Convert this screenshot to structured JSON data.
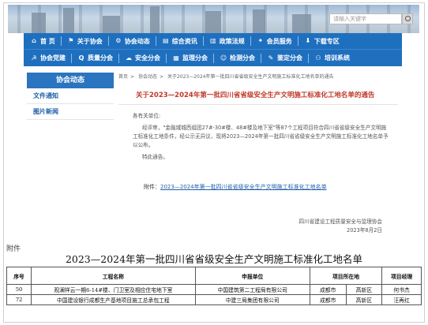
{
  "header": {
    "search_placeholder": "请输入关键字"
  },
  "nav": {
    "row1": [
      {
        "icon": "home-icon",
        "glyph": "⌂",
        "label": "首 页"
      },
      {
        "icon": "flag-icon",
        "glyph": "⚑",
        "label": "关于协会"
      },
      {
        "icon": "news-icon",
        "glyph": "⚙",
        "label": "协会动态"
      },
      {
        "icon": "doc-icon",
        "glyph": "▤",
        "label": "综合资讯"
      },
      {
        "icon": "book-icon",
        "glyph": "▥",
        "label": "政策法规"
      },
      {
        "icon": "star-icon",
        "glyph": "✦",
        "label": "会员服务"
      },
      {
        "icon": "download-icon",
        "glyph": "⬇",
        "label": "下载专区"
      }
    ],
    "row2": [
      {
        "icon": "party-icon",
        "glyph": "☭",
        "label": "协会党建"
      },
      {
        "icon": "quality-icon",
        "glyph": "Q",
        "label": "质量分会"
      },
      {
        "icon": "safety-icon",
        "glyph": "☁",
        "label": "安全分会"
      },
      {
        "icon": "supervise-icon",
        "glyph": "▦",
        "label": "监理分会"
      },
      {
        "icon": "test-icon",
        "glyph": "☺",
        "label": "检测分会"
      },
      {
        "icon": "eval-icon",
        "glyph": "✎",
        "label": "鉴定分会"
      },
      {
        "icon": "train-icon",
        "glyph": "⚇",
        "label": "培训系统"
      }
    ]
  },
  "sidebar": {
    "heading": "协会动态",
    "items": [
      "文件通知",
      "图片新闻"
    ]
  },
  "breadcrumb": [
    "首页",
    "协会动态",
    "关于2023—2024年第一批四川省省级安全生产文明施工标准化工地名单的通告"
  ],
  "article": {
    "title": "关于2023—2024年第一批四川省省级安全生产文明施工标准化工地名单的通告",
    "greeting": "各有关单位:",
    "paragraph": "经评审，\"金融城城西组团27#-30#楼、48#楼及地下室\"等87个工程项目符合四川省省级安全生产文明施工标准化工地条件，经公示无异议，现将2023—2024年第一批四川省省级安全生产文明施工标准化工地名单予以公布。",
    "closing": "特此通告。",
    "attachment_prefix": "附件：",
    "attachment_link": "2023—2024年第一批四川省省级安全生产文明施工标准化工地名单",
    "issuer": "四川省建设工程质量安全与监理协会",
    "date": "2023年8月2日"
  },
  "doc": {
    "label": "附件",
    "title": "2023—2024年第一批四川省省级安全生产文明施工标准化工地名单",
    "columns": [
      "序号",
      "工程名称",
      "申报单位",
      "项目所在地",
      "项目经理"
    ],
    "rows": [
      [
        "50",
        "观澜祥云一期6-14#楼、门卫室及相应住宅地下室",
        "中国建筑第二工程局有限公司",
        "成都市",
        "高新区",
        "何书杰"
      ],
      [
        "72",
        "中国建设银行成都生产基地项目施工总承包工程",
        "中建三局集团有限公司",
        "成都市",
        "高新区",
        "汪再红"
      ]
    ]
  }
}
